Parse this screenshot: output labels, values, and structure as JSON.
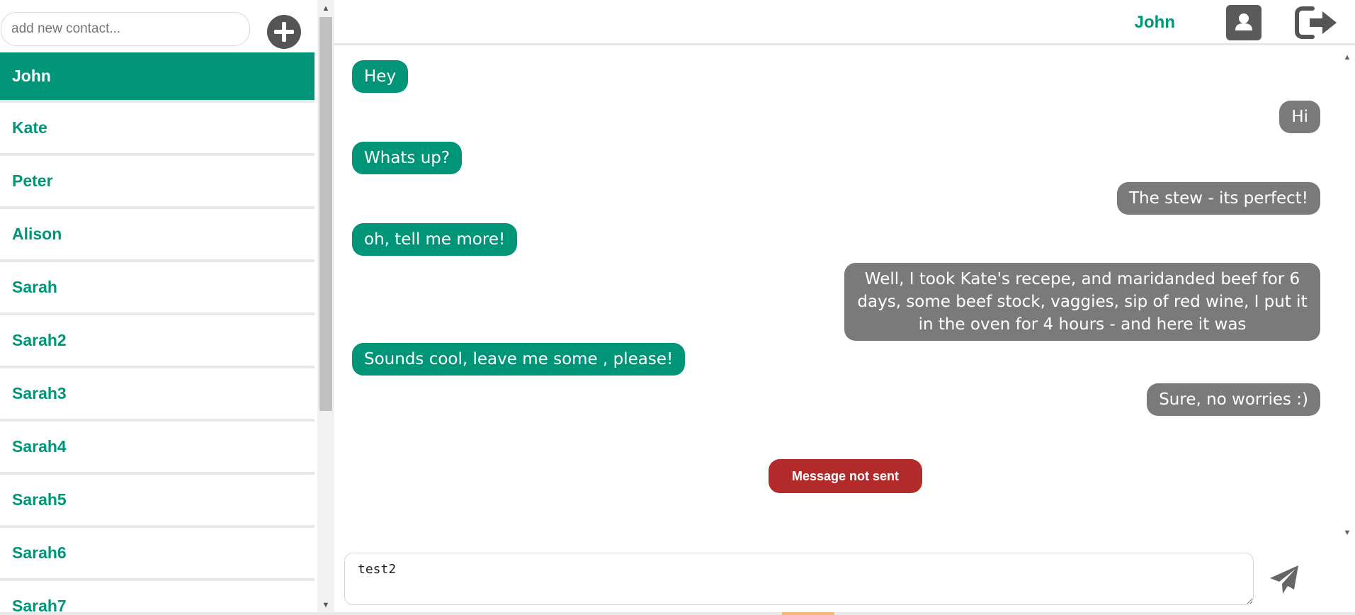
{
  "sidebar": {
    "add_contact_placeholder": "add new contact...",
    "contacts": [
      "John",
      "Kate",
      "Peter",
      "Alison",
      "Sarah",
      "Sarah2",
      "Sarah3",
      "Sarah4",
      "Sarah5",
      "Sarah6",
      "Sarah7"
    ],
    "active_contact": "John"
  },
  "header": {
    "contact_name": "John"
  },
  "messages": [
    {
      "direction": "in",
      "text": "Hey"
    },
    {
      "direction": "out",
      "text": "Hi"
    },
    {
      "direction": "in",
      "text": "Whats up?"
    },
    {
      "direction": "out",
      "text": "The stew - its perfect!"
    },
    {
      "direction": "in",
      "text": "oh, tell me more!"
    },
    {
      "direction": "out",
      "text": "Well, I took Kate's recepe, and maridanded beef for 6 days, some beef stock, vaggies, sip of red wine, I put it in the oven for 4 hours - and here it was"
    },
    {
      "direction": "in",
      "text": "Sounds cool, leave me some , please!"
    },
    {
      "direction": "out",
      "text": "Sure, no worries :)"
    }
  ],
  "status": {
    "error_text": "Message not sent"
  },
  "composer": {
    "value": "test2"
  },
  "colors": {
    "accent": "#009578",
    "outgoing_bubble": "#7a7a7a",
    "error": "#b22a2a",
    "icon_dark": "#555555"
  },
  "icons": {
    "add": "plus-circle-icon",
    "profile": "user-icon",
    "logout": "sign-out-icon",
    "send": "paper-plane-icon"
  }
}
